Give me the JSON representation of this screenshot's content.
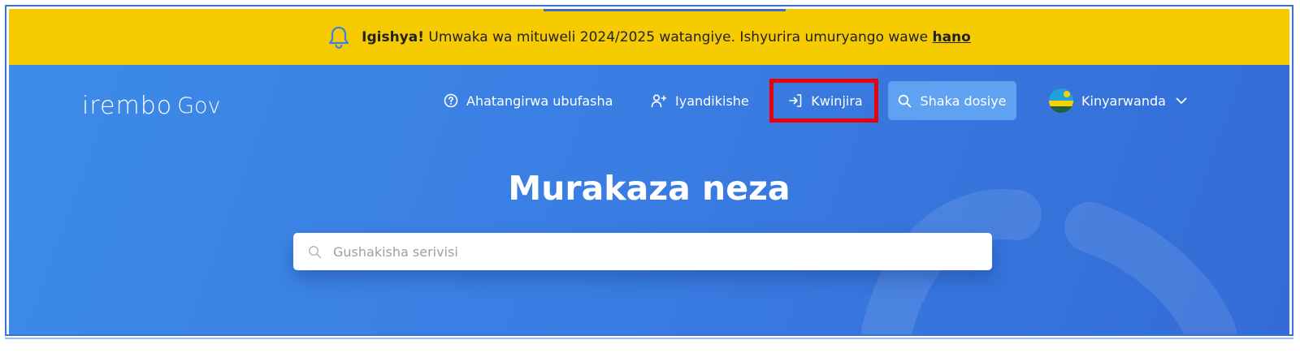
{
  "banner": {
    "bold": "Igishya!",
    "message": " Umwaka wa mituweli 2024/2025 watangiye. Ishyurira umuryango wawe ",
    "link": "hano",
    "icon": "bell-icon"
  },
  "logo": {
    "word": "irembo",
    "suffix": "Gov"
  },
  "nav": {
    "help": "Ahatangirwa ubufasha",
    "register": "Iyandikishe",
    "login": "Kwinjira",
    "track": "Shaka dosiye",
    "language": "Kinyarwanda"
  },
  "hero": {
    "title": "Murakaza neza"
  },
  "search": {
    "placeholder": "Gushakisha serivisi"
  },
  "colors": {
    "banner": "#f6cb02",
    "hero": "#3a7ee3",
    "track_button": "#5fa2f1",
    "highlight": "#e8000b"
  }
}
